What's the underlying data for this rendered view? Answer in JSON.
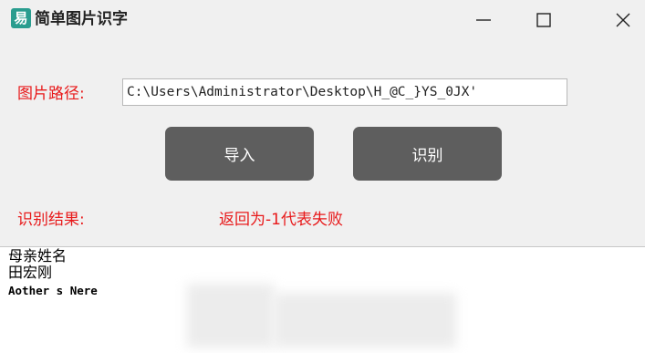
{
  "window": {
    "app_icon_glyph": "易",
    "title": "简单图片识字"
  },
  "path": {
    "label": "图片路径:",
    "value": "C:\\Users\\Administrator\\Desktop\\H_@C_}YS_0JX'"
  },
  "buttons": {
    "import_label": "导入",
    "recognize_label": "识别"
  },
  "result": {
    "label": "识别结果:",
    "status": "返回为-1代表失败"
  },
  "output": {
    "lines": [
      "母亲姓名",
      "田宏刚",
      "Aother s Nere"
    ]
  },
  "colors": {
    "accent_red": "#e8191a",
    "button_bg": "#5e5e5e",
    "window_bg": "#f0f0f0"
  }
}
